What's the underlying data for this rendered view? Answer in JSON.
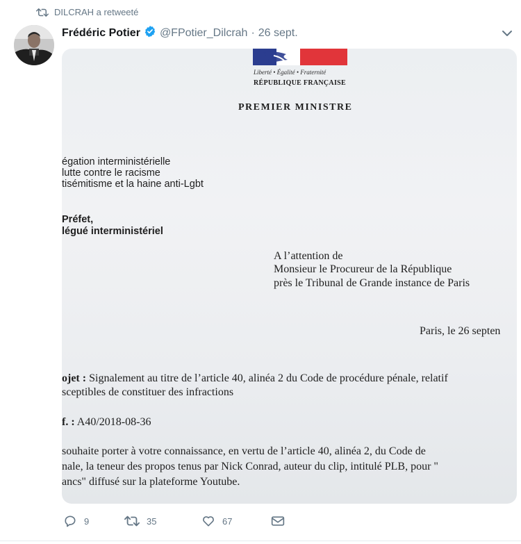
{
  "retweet": {
    "label": "DILCRAH a retweeté"
  },
  "tweet": {
    "author_name": "Frédéric Potier",
    "handle": "@FPotier_Dilcrah",
    "separator": "·",
    "date": "26 sept.",
    "verified": true,
    "accent_color": "#1da1f2"
  },
  "document": {
    "motto": "Liberté • Égalité • Fraternité",
    "republic": "RÉPUBLIQUE FRANÇAISE",
    "ministry": "PREMIER MINISTRE",
    "sender": [
      "égation interministérielle",
      "lutte contre le racisme",
      "tisémitisme et la haine anti-Lgbt"
    ],
    "title": [
      "Préfet,",
      "légué interministériel"
    ],
    "recipient": [
      "A l’attention de",
      "Monsieur le Procureur de la République",
      "près le Tribunal de Grande instance de Paris"
    ],
    "date_line": "Paris, le 26 septen",
    "subject_label": "ojet :",
    "subject_text": "Signalement au titre de l’article 40, alinéa 2 du Code de procédure pénale, relatif",
    "subject_line2": "sceptibles de constituer des infractions",
    "ref_label": "f. :",
    "ref_value": "A40/2018-08-36",
    "body": [
      "souhaite porter à votre connaissance, en vertu de l’article 40, alinéa 2, du Code de",
      "nale, la teneur des propos tenus par Nick Conrad, auteur du clip, intitulé PLB, pour \"",
      "ancs\" diffusé sur la plateforme Youtube."
    ]
  },
  "actions": {
    "replies": "9",
    "retweets": "35",
    "likes": "67"
  },
  "icons": [
    "retweet-icon",
    "verified-badge-icon",
    "chevron-down-icon",
    "reply-icon",
    "like-icon",
    "message-icon"
  ]
}
